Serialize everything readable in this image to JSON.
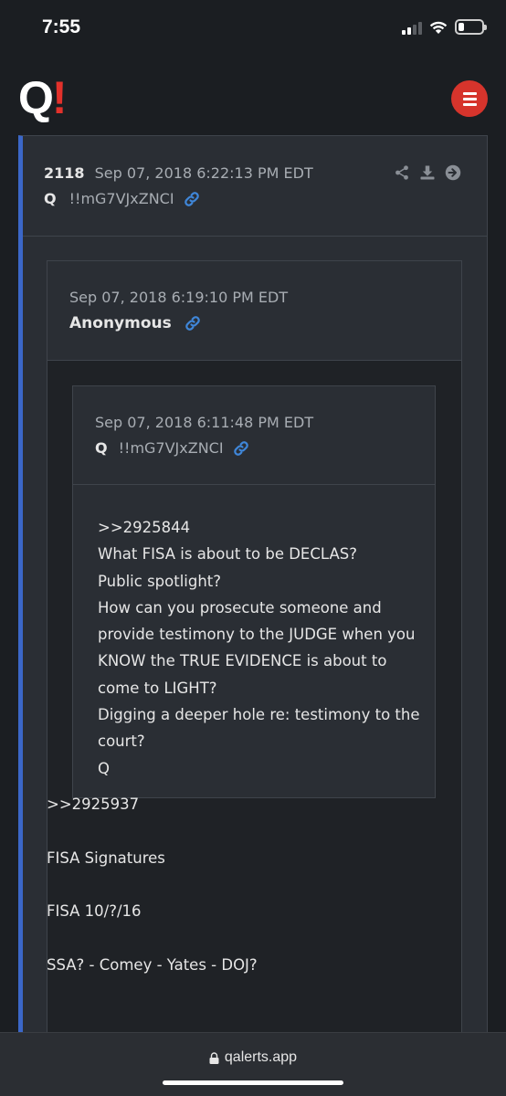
{
  "status_bar": {
    "time": "7:55"
  },
  "header": {
    "logo_q": "Q",
    "logo_bang": "!"
  },
  "post": {
    "number": "2118",
    "timestamp": "Sep 07, 2018 6:22:13 PM EDT",
    "author_name": "Q",
    "tripcode": "!!mG7VJxZNCI",
    "quote": {
      "timestamp": "Sep 07, 2018 6:19:10 PM EDT",
      "author_name": "Anonymous",
      "nested_quote": {
        "timestamp": "Sep 07, 2018 6:11:48 PM EDT",
        "author_name": "Q",
        "tripcode": "!!mG7VJxZNCI",
        "lines": [
          ">>2925844",
          "What FISA is about to be DECLAS?",
          "Public spotlight?",
          "How can you prosecute someone and",
          "provide testimony to the JUDGE when you",
          "KNOW the TRUE EVIDENCE is about to",
          "come to LIGHT?",
          "Digging a deeper hole re: testimony to the",
          "court?",
          "Q"
        ]
      },
      "paragraphs": [
        ">>2925937",
        "FISA Signatures",
        "FISA 10/?/16",
        "SSA? - Comey - Yates - DOJ?"
      ]
    }
  },
  "browser": {
    "url": "qalerts.app"
  },
  "colors": {
    "accent_blue": "#3b67c8",
    "menu_red": "#d6342c",
    "link_blue": "#3f86d8"
  },
  "icons": [
    "share-icon",
    "download-icon",
    "arrow-right-circle-icon",
    "link-icon",
    "lock-icon",
    "menu-icon"
  ]
}
